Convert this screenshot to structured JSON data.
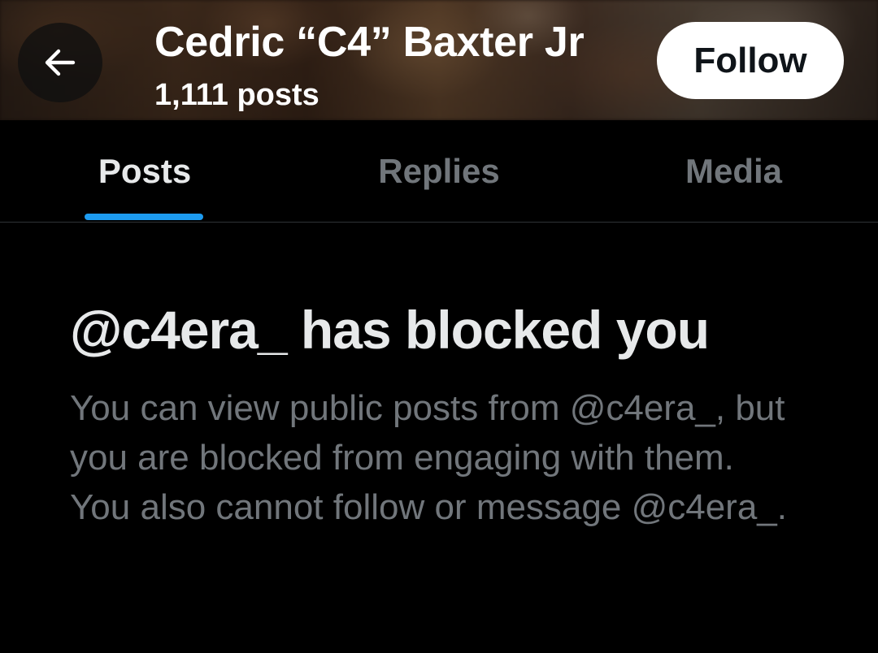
{
  "header": {
    "back_icon": "arrow-left-icon",
    "name": "Cedric “C4” Baxter Jr",
    "post_count": "1,111 posts",
    "follow_label": "Follow"
  },
  "tabs": [
    {
      "label": "Posts",
      "active": true
    },
    {
      "label": "Replies",
      "active": false
    },
    {
      "label": "Media",
      "active": false
    }
  ],
  "blocked": {
    "title": "@c4era_ has blocked you",
    "description": "You can view public posts from @c4era_, but you are blocked from engaging with them. You also cannot follow or message @c4era_."
  },
  "colors": {
    "background": "#000000",
    "tab_indicator": "#1d9bf0",
    "primary_text": "#e7e9ea",
    "secondary_text": "#71767b",
    "follow_button_bg": "#ffffff"
  }
}
